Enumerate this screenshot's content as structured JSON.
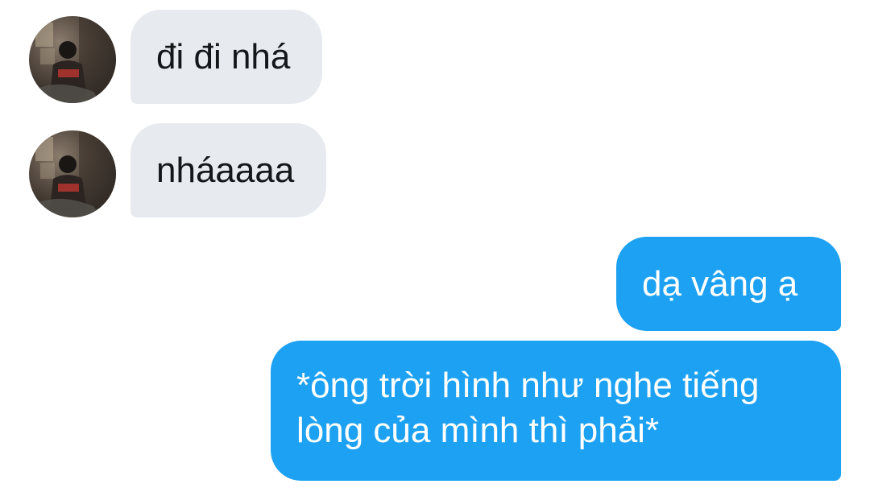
{
  "conversation": {
    "messages": [
      {
        "direction": "incoming",
        "text": "đi đi nhá",
        "avatar_icon": "user-avatar-photo"
      },
      {
        "direction": "incoming",
        "text": "nháaaaa",
        "avatar_icon": "user-avatar-photo"
      },
      {
        "direction": "outgoing",
        "text": "dạ vâng ạ"
      },
      {
        "direction": "outgoing",
        "lines": [
          "*ông trời hình như nghe tiếng",
          "lòng của mình thì phải*"
        ]
      }
    ]
  },
  "colors": {
    "incoming_bubble": "#e7ebef",
    "incoming_text": "#14171a",
    "outgoing_bubble": "#1da1f2",
    "outgoing_text": "#ffffff",
    "background": "#ffffff"
  }
}
